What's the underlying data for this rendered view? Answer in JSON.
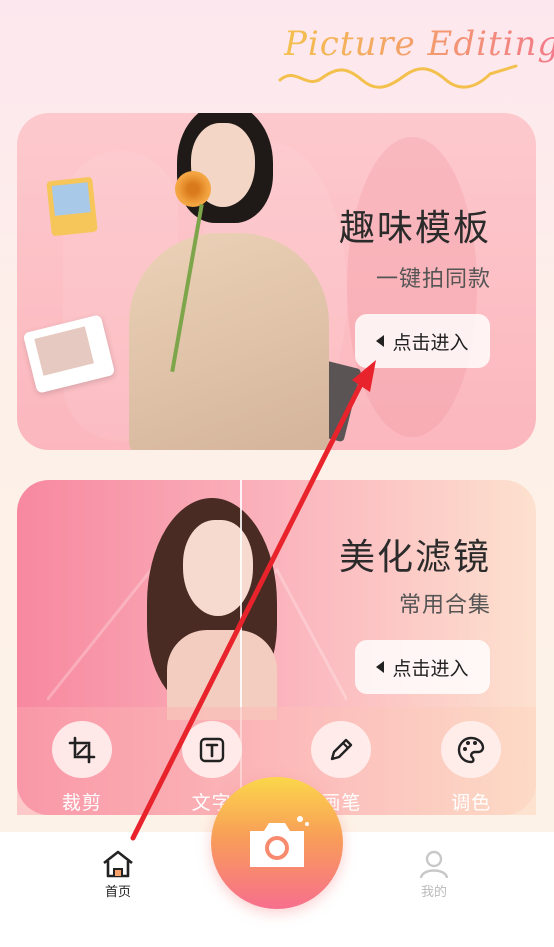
{
  "header": {
    "logo_text": "Picture Editing"
  },
  "cards": [
    {
      "title": "趣味模板",
      "subtitle": "一键拍同款",
      "button": "点击进入"
    },
    {
      "title": "美化滤镜",
      "subtitle": "常用合集",
      "button": "点击进入"
    }
  ],
  "tools": [
    {
      "label": "裁剪",
      "icon": "crop-icon"
    },
    {
      "label": "文字",
      "icon": "text-icon"
    },
    {
      "label": "画笔",
      "icon": "pencil-icon"
    },
    {
      "label": "调色",
      "icon": "palette-icon"
    }
  ],
  "bottom_nav": {
    "home_label": "首页",
    "me_label": "我的",
    "camera_icon": "camera-icon"
  },
  "colors": {
    "accent_pink": "#f76f8d",
    "accent_yellow": "#fbd74a",
    "arrow_red": "#e8232b"
  }
}
